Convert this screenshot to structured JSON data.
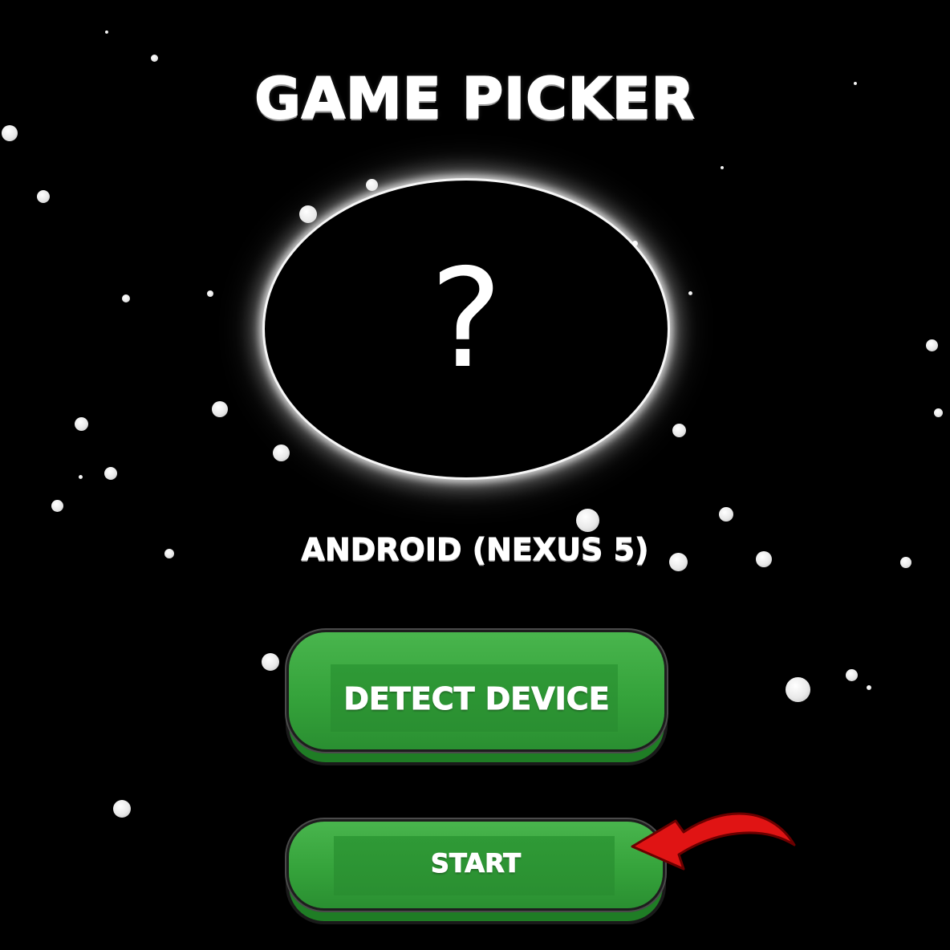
{
  "screen": {
    "title": "GAME PICKER",
    "selection_placeholder": "?",
    "device_label": "ANDROID (NEXUS 5)"
  },
  "buttons": {
    "detect_label": "DETECT DEVICE",
    "start_label": "START"
  },
  "colors": {
    "background": "#000000",
    "button_green": "#35a33b",
    "button_shadow": "#1f7d25",
    "arrow_red": "#e01414",
    "text": "#ffffff"
  },
  "icons": {
    "pointer": "curved-arrow-icon",
    "decoration": "star-dots"
  }
}
